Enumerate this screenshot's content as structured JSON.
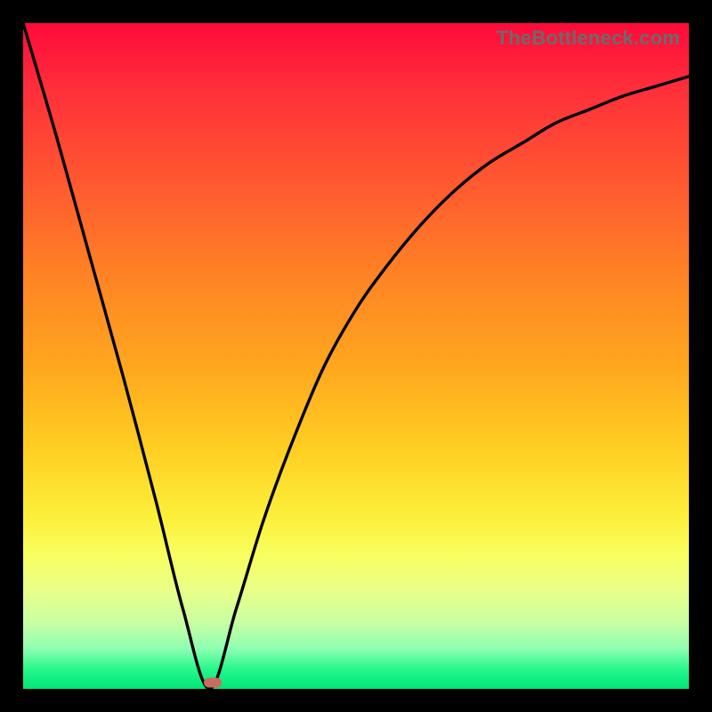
{
  "watermark": "TheBottleneck.com",
  "marker": {
    "x_pct": 28.5,
    "y_pct": 99.0
  },
  "colors": {
    "curve": "#000000",
    "marker": "#cb6a60",
    "gradient_top": "#ff0a3a",
    "gradient_bottom": "#00e676",
    "frame": "#000000"
  },
  "chart_data": {
    "type": "line",
    "title": "",
    "xlabel": "",
    "ylabel": "",
    "xlim": [
      0,
      100
    ],
    "ylim": [
      0,
      100
    ],
    "grid": false,
    "legend": false,
    "annotations": [
      "TheBottleneck.com"
    ],
    "note": "Background encodes bottleneck severity: green≈0 (good) at bottom, red≈100 (bad) at top. Curve minimum ≈ x=28 where bottleneck ≈ 0.",
    "series": [
      {
        "name": "bottleneck-curve",
        "x": [
          0,
          5,
          10,
          15,
          20,
          24,
          28,
          32,
          36,
          40,
          45,
          50,
          55,
          60,
          65,
          70,
          75,
          80,
          85,
          90,
          95,
          100
        ],
        "values": [
          100,
          83,
          65,
          47,
          28,
          12,
          0,
          12,
          25,
          36,
          48,
          57,
          64,
          70,
          75,
          79,
          82,
          85,
          87,
          89,
          90.5,
          92
        ]
      }
    ],
    "marker_point": {
      "x": 28,
      "y": 1
    }
  }
}
